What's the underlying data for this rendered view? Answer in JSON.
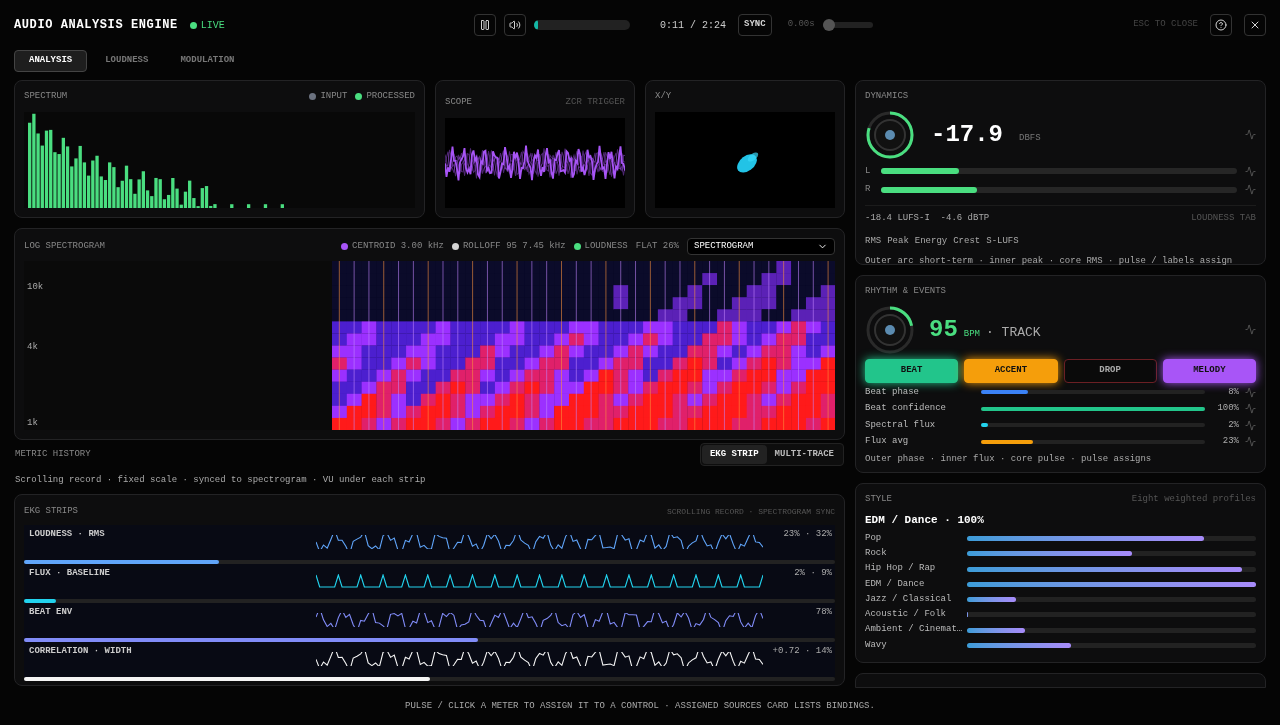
{
  "header": {
    "title": "AUDIO ANALYSIS ENGINE",
    "live": {
      "label": "LIVE",
      "on": true
    },
    "playing": true,
    "progress": {
      "level": 0.04
    },
    "time": "0:11 / 2:24",
    "sync": "SYNC",
    "latency": {
      "reading": "0.00s",
      "level": 0.0
    },
    "close_hint": "ESC TO CLOSE"
  },
  "tabs": [
    {
      "label": "ANALYSIS",
      "selected": true
    },
    {
      "label": "LOUDNESS",
      "selected": false
    },
    {
      "label": "MODULATION",
      "selected": false
    }
  ],
  "spectrum": {
    "title": "SPECTRUM",
    "legend": [
      {
        "label": "INPUT",
        "color": "#6b7280"
      },
      {
        "label": "PROCESSED",
        "color": "#4ade80"
      }
    ]
  },
  "scope": {
    "title": "SCOPE",
    "trigger": "ZCR TRIGGER"
  },
  "xy": {
    "title": "X/Y"
  },
  "spectrogram": {
    "title": "LOG SPECTROGRAM",
    "legend": [
      {
        "label": "CENTROID 3.00 kHz",
        "color": "#a855f7"
      },
      {
        "label": "ROLLOFF 95 7.45 kHz",
        "color": "#d4d4d4"
      },
      {
        "label": "LOUDNESS",
        "color": "#4ade80"
      }
    ],
    "flatness": "FLAT 26%",
    "view": "SPECTROGRAM",
    "axis": [
      "10k",
      "4k",
      "1k"
    ]
  },
  "metric_history": {
    "title": "METRIC HISTORY",
    "subtitle": "Scrolling record · fixed scale · synced to spectrogram · VU under each strip",
    "modes": [
      {
        "label": "EKG STRIP",
        "selected": true
      },
      {
        "label": "MULTI-TRACE",
        "selected": false
      }
    ]
  },
  "ekg": {
    "title": "EKG STRIPS",
    "subtitle": "SCROLLING RECORD · SPECTROGRAM SYNC",
    "strips": [
      {
        "label": "LOUDNESS · RMS",
        "reading": "23% · 32%",
        "level": 0.24,
        "color": "#60a5fa"
      },
      {
        "label": "FLUX · BASELINE",
        "reading": "2% · 9%",
        "level": 0.04,
        "color": "#22d3ee"
      },
      {
        "label": "BEAT ENV",
        "reading": "78%",
        "level": 0.56,
        "color": "#818cf8"
      },
      {
        "label": "CORRELATION · WIDTH",
        "reading": "+0.72 · 14%",
        "level": 0.5,
        "color": "#f5f5f5"
      }
    ]
  },
  "dynamics": {
    "title": "DYNAMICS",
    "value": "-17.9",
    "unit": "DBFS",
    "channels": [
      {
        "label": "L",
        "level": 0.22
      },
      {
        "label": "R",
        "level": 0.27
      }
    ],
    "stats": "-18.4 LUFS-I  -4.6 dBTP",
    "link": "LOUDNESS TAB",
    "tags": [
      "RMS",
      "Peak",
      "Energy",
      "Crest",
      "S-LUFS"
    ],
    "note": "Outer arc short-term · inner peak · core RMS · pulse / labels assign"
  },
  "rhythm": {
    "title": "RHYTHM & EVENTS",
    "bpm": "95",
    "unit": "BPM",
    "mode": "· TRACK",
    "events": [
      {
        "label": "BEAT",
        "color": "#22c58b",
        "on": true
      },
      {
        "label": "ACCENT",
        "color": "#f59e0b",
        "on": true
      },
      {
        "label": "DROP",
        "color": "#6b1f24",
        "on": false
      },
      {
        "label": "MELODY",
        "color": "#a855f7",
        "on": true
      }
    ],
    "meters": [
      {
        "label": "Beat phase",
        "level": 0.21,
        "reading": "8%",
        "color": "#3b82f6"
      },
      {
        "label": "Beat confidence",
        "level": 1.0,
        "reading": "100%",
        "color": "#22c58b"
      },
      {
        "label": "Spectral flux",
        "level": 0.03,
        "reading": "2%",
        "color": "#22d3ee"
      },
      {
        "label": "Flux avg",
        "level": 0.23,
        "reading": "23%",
        "color": "#f59e0b"
      }
    ],
    "note": "Outer phase · inner flux · core pulse · pulse assigns"
  },
  "style": {
    "title": "STYLE",
    "hint": "Eight weighted profiles",
    "top": "EDM / Dance · 100%",
    "profiles": [
      {
        "label": "Pop",
        "level": 0.82
      },
      {
        "label": "Rock",
        "level": 0.57
      },
      {
        "label": "Hip Hop / Rap",
        "level": 0.95
      },
      {
        "label": "EDM / Dance",
        "level": 1.0
      },
      {
        "label": "Jazz / Classical",
        "level": 0.17
      },
      {
        "label": "Acoustic / Folk",
        "level": 0.005
      },
      {
        "label": "Ambient / Cinemat…",
        "level": 0.2
      },
      {
        "label": "Wavy",
        "level": 0.36
      }
    ]
  },
  "footer": "PULSE / CLICK A METER TO ASSIGN IT TO A CONTROL · ASSIGNED SOURCES CARD LISTS BINDINGS."
}
